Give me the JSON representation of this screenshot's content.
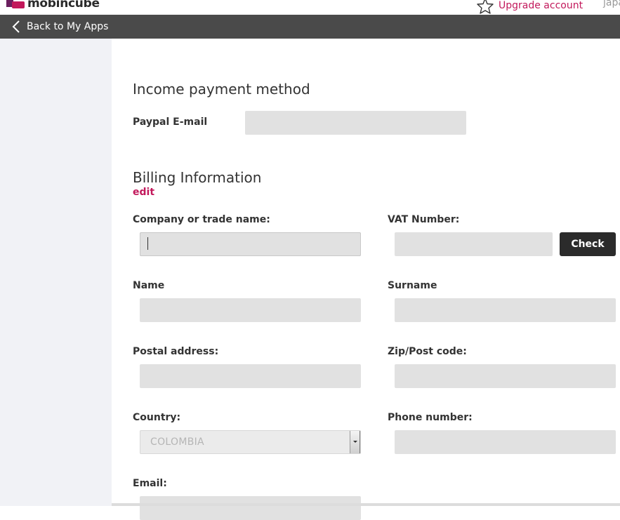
{
  "header": {
    "brand": "mobincube",
    "upgrade_label": "Upgrade account",
    "language_label": "japa",
    "accent_color": "#c2185b"
  },
  "nav": {
    "back_label": "Back to My Apps"
  },
  "income": {
    "title": "Income payment method",
    "paypal_label": "Paypal E-mail",
    "paypal_value": ""
  },
  "billing": {
    "title": "Billing Information",
    "edit_label": "edit",
    "company_label": "Company or trade name:",
    "company_value": "",
    "vat_label": "VAT Number:",
    "vat_value": "",
    "check_label": "Check",
    "name_label": "Name",
    "name_value": "",
    "surname_label": "Surname",
    "surname_value": "",
    "postal_label": "Postal address:",
    "postal_value": "",
    "zip_label": "Zip/Post code:",
    "zip_value": "",
    "country_label": "Country:",
    "country_value": "COLOMBIA",
    "phone_label": "Phone number:",
    "phone_value": "",
    "email_label": "Email:",
    "email_value": ""
  },
  "icons": {
    "upgrade": "star-outline-icon",
    "back": "chevron-left-icon",
    "select": "dropdown-arrow-icon"
  }
}
